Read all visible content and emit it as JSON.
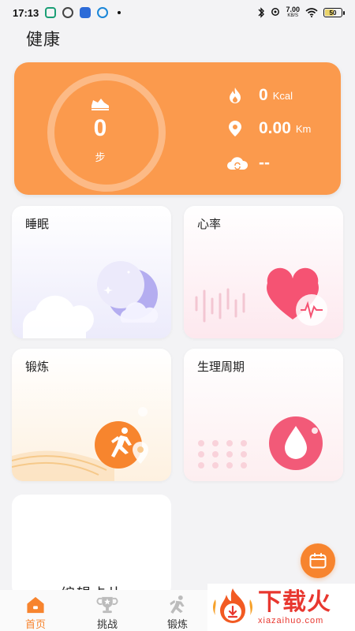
{
  "status_bar": {
    "time": "17:13",
    "net_speed": "7.00",
    "net_unit": "KB/S",
    "battery": "50"
  },
  "page": {
    "title": "健康"
  },
  "summary": {
    "steps": "0",
    "steps_unit": "步",
    "calories_value": "0",
    "calories_unit": "Kcal",
    "distance_value": "0.00",
    "distance_unit": "Km",
    "weather_value": "--"
  },
  "cards": {
    "sleep": "睡眠",
    "heart_rate": "心率",
    "exercise": "锻炼",
    "period": "生理周期",
    "edit": "编辑卡片"
  },
  "nav": {
    "home": "首页",
    "challenge": "挑战",
    "exercise": "锻炼"
  },
  "watermark": {
    "cn": "下载火",
    "en": "xiazaihuo.com"
  },
  "colors": {
    "accent": "#f7842e",
    "summary_bg": "#fb9a4d",
    "sleep_moon": "#8e86e8",
    "heart": "#f44f6e",
    "watermark": "#e8372f"
  },
  "icons": {
    "steps": "shoe-icon",
    "calories": "flame-icon",
    "distance": "location-pin-icon",
    "weather": "cloud-icon",
    "calendar": "calendar-icon",
    "home": "home-icon",
    "challenge": "trophy-icon",
    "exercise": "runner-icon"
  }
}
